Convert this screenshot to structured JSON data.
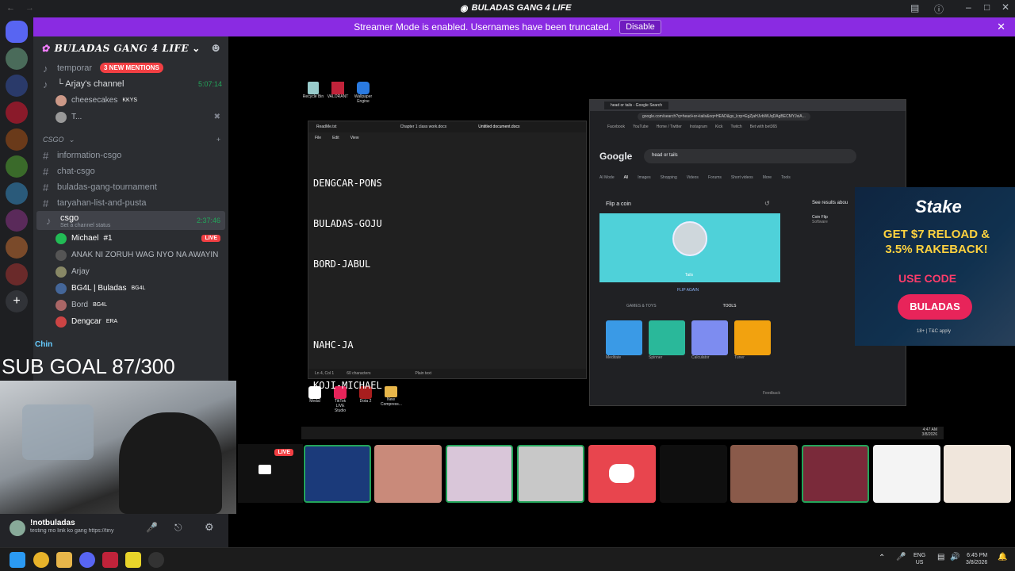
{
  "window": {
    "title": "BULADAS GANG 4 LIFE"
  },
  "banner": {
    "text": "Streamer Mode is enabled. Usernames have been truncated.",
    "button": "Disable"
  },
  "guild": {
    "name": "BULADAS GANG 4 LIFE",
    "mentions": "3 NEW MENTIONS"
  },
  "channels": {
    "voice1": "temporar",
    "voice2": "└ Arjay's channel",
    "voice2_time": "5:07:14",
    "v_users": [
      "cheesecakes",
      "T..."
    ],
    "v_badge": "KKYS",
    "category": "CSGO",
    "text_channels": [
      "information-csgo",
      "chat-csgo",
      "buladas-gang-tournament",
      "taryahan-list-and-pusta"
    ],
    "active": "csgo",
    "active_time": "2:37:46",
    "active_status": "Set a channel status",
    "members": [
      {
        "name": "Michael",
        "tag": "#1",
        "live": "LIVE"
      },
      {
        "name": "ANAK NI ZORUH WAG NYO NA AWAYIN"
      },
      {
        "name": "Arjay"
      },
      {
        "name": "BG4L | Buladas",
        "tag": "BG4L"
      },
      {
        "name": "Bord",
        "tag": "BG4L"
      },
      {
        "name": "Dengcar",
        "tag": "ERA"
      }
    ]
  },
  "overlay": {
    "chatter": "Chin",
    "sub_goal": "SUB GOAL 87/300",
    "live": "LIVE"
  },
  "userpanel": {
    "name": "!notbuladas",
    "status": "testing mo link ko gang https://tiny"
  },
  "desktop": {
    "icons": [
      "Recycle Bin",
      "VALORANT",
      "Wallpaper Engine"
    ],
    "icons_bottom": [
      "Medal",
      "TikTok LIVE Studio",
      "Dota 2",
      "New Compress..."
    ]
  },
  "notepad": {
    "tabs": [
      "ReadMe.txt",
      "Chapter 1 class work.docx",
      "Untitled document.docx"
    ],
    "menu": [
      "File",
      "Edit",
      "View"
    ],
    "lines": [
      "DENGCAR-PONS",
      "BULADAS-GOJU",
      "BORD-JABUL",
      "",
      "NAHC-JA",
      "KOJI-MICHAEL"
    ],
    "status_pos": "Ln 4, Col 1",
    "status_chars": "60 characters",
    "status_mode": "Plain text"
  },
  "chrome": {
    "tab": "head or tails - Google Search",
    "url": "google.com/search?q=head+or+tails&oq=HEAD&gs_lcrp=EgZjaHJvbWUqDAgBECMYJxiA...",
    "bookmarks": [
      "Facebook",
      "YouTube",
      "Home / Twitter",
      "Instagram",
      "Kick",
      "Twitch",
      "Bet with bet365"
    ],
    "query": "head or tails",
    "nav": [
      "AI Mode",
      "All",
      "Images",
      "Shopping",
      "Videos",
      "Forums",
      "Short videos",
      "More",
      "Tools"
    ],
    "card_title": "Flip a coin",
    "coin": "Tails",
    "flip_again": "FLIP AGAIN",
    "tabs2": [
      "GAMES & TOYS",
      "TOOLS"
    ],
    "tools": [
      "Meditate",
      "Spinner",
      "Calculator",
      "Tuner"
    ],
    "see_results": "See results abou",
    "side_item": "Coin Flip",
    "side_sub": "Software",
    "feedback": "Feedback"
  },
  "stake": {
    "brand": "Stake",
    "headline": "GET $7 RELOAD & 3.5% RAKEBACK!",
    "code_label": "USE CODE",
    "code": "BULADAS",
    "fine": "18+ | T&C apply"
  },
  "inner_clock": {
    "time": "4:47 AM",
    "date": "3/8/2026"
  },
  "taskbar": {
    "lang1": "ENG",
    "lang2": "US",
    "time": "6:45 PM",
    "date": "3/8/2026"
  }
}
